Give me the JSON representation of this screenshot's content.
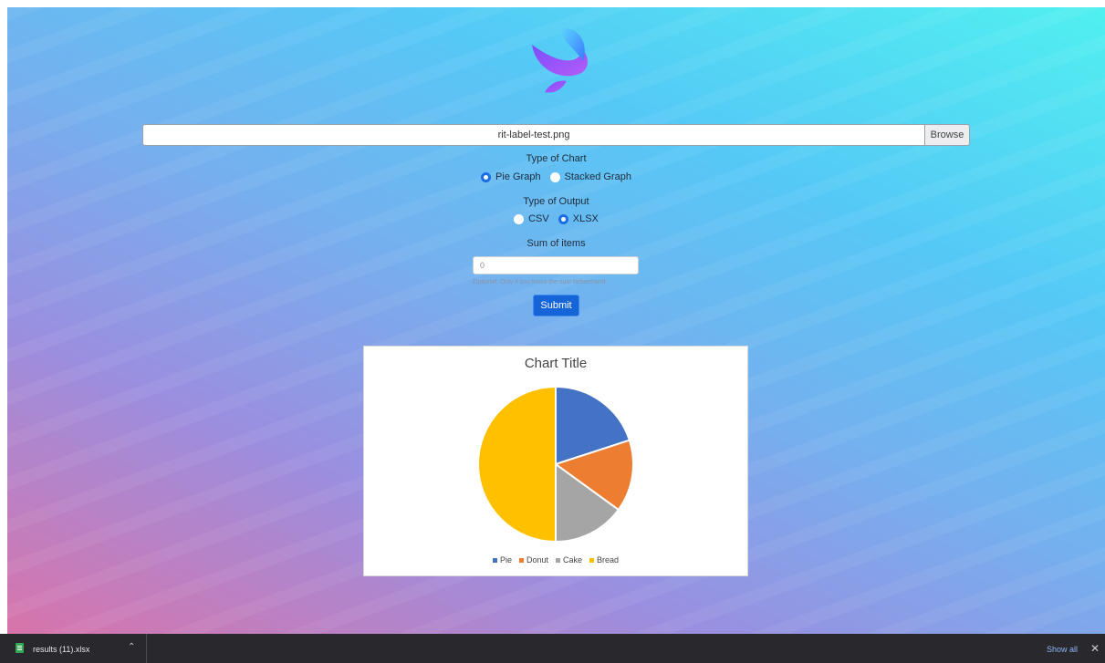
{
  "form": {
    "file_name": "rit-label-test.png",
    "browse_label": "Browse",
    "chart_type_label": "Type of Chart",
    "chart_type_options": [
      {
        "label": "Pie Graph",
        "checked": true
      },
      {
        "label": "Stacked Graph",
        "checked": false
      }
    ],
    "output_type_label": "Type of Output",
    "output_type_options": [
      {
        "label": "CSV",
        "checked": false
      },
      {
        "label": "XLSX",
        "checked": true
      }
    ],
    "sum_label": "Sum of items",
    "sum_placeholder": "0",
    "sum_hint": "Optional: Only if you know the sum beforehand.",
    "submit_label": "Submit"
  },
  "chart_data": {
    "type": "pie",
    "title": "Chart Title",
    "labels": [
      "Pie",
      "Donut",
      "Cake",
      "Bread"
    ],
    "values": [
      20,
      15,
      15,
      50
    ],
    "colors": [
      "#4472c4",
      "#ed7d31",
      "#a5a5a5",
      "#ffc000"
    ],
    "legend_position": "bottom"
  },
  "download_bar": {
    "file_name": "results (11).xlsx",
    "show_all_label": "Show all",
    "file_icon": "spreadsheet-icon",
    "chevron_icon": "chevron-up-icon",
    "close_icon": "close-icon"
  }
}
